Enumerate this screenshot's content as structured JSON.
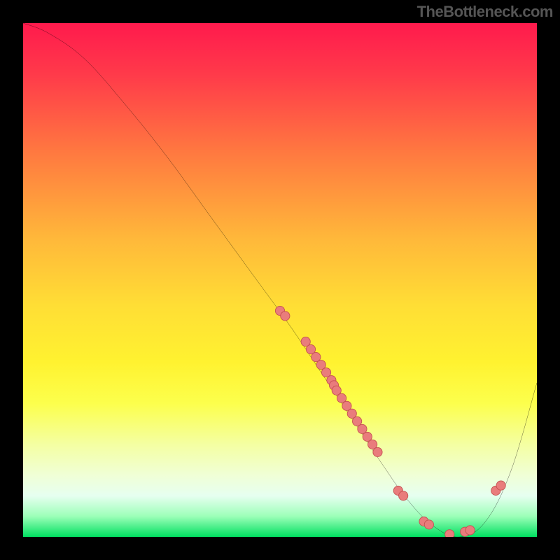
{
  "attribution": "TheBottleneck.com",
  "chart_data": {
    "type": "line",
    "title": "",
    "xlabel": "",
    "ylabel": "",
    "xlim": [
      0,
      100
    ],
    "ylim": [
      0,
      100
    ],
    "curve": {
      "x": [
        0,
        5,
        12,
        20,
        28,
        36,
        44,
        52,
        58,
        64,
        70,
        75,
        80,
        85,
        90,
        95,
        100
      ],
      "y": [
        100,
        98,
        93,
        84,
        74,
        63,
        52,
        41,
        32,
        23,
        14,
        7,
        2,
        0,
        3,
        13,
        30
      ]
    },
    "scatter": {
      "x": [
        50,
        51,
        55,
        56,
        57,
        58,
        59,
        60,
        60.5,
        61,
        62,
        63,
        64,
        65,
        66,
        67,
        68,
        69,
        73,
        74,
        78,
        79,
        83,
        86,
        87,
        92,
        93
      ],
      "y": [
        44,
        43,
        38,
        36.5,
        35,
        33.5,
        32,
        30.5,
        29.5,
        28.5,
        27,
        25.5,
        24,
        22.5,
        21,
        19.5,
        18,
        16.5,
        9,
        8,
        3,
        2.4,
        0.5,
        1,
        1.3,
        9,
        10
      ]
    },
    "colors": {
      "curve": "#000000",
      "points_fill": "#e97c7c",
      "points_stroke": "#c45050"
    }
  }
}
